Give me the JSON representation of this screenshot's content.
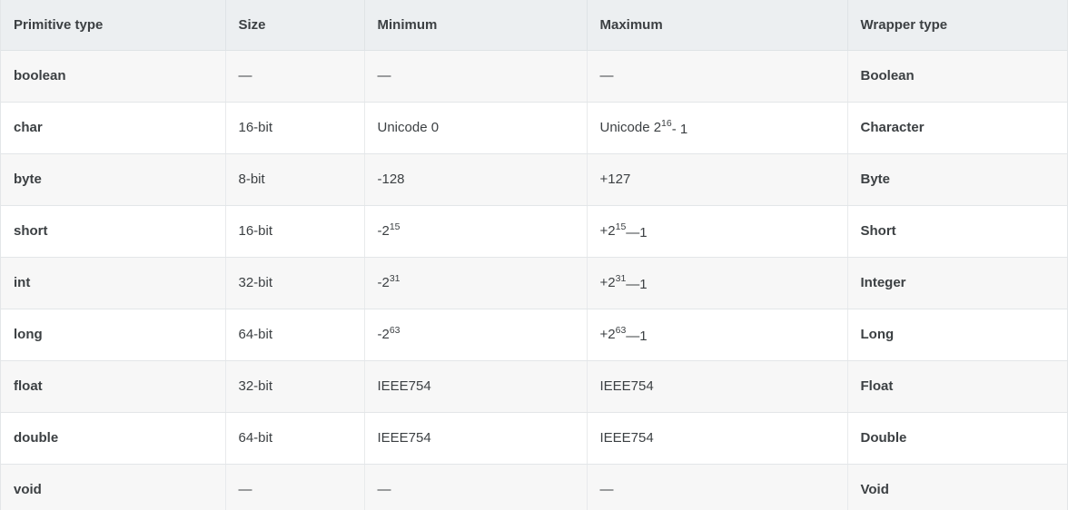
{
  "table": {
    "columns": [
      {
        "key": "primitive",
        "label": "Primitive type"
      },
      {
        "key": "size",
        "label": "Size"
      },
      {
        "key": "minimum",
        "label": "Minimum"
      },
      {
        "key": "maximum",
        "label": "Maximum"
      },
      {
        "key": "wrapper",
        "label": "Wrapper type"
      }
    ],
    "rows": [
      {
        "primitive": "boolean",
        "size": "—",
        "minimum": "—",
        "maximum": "—",
        "wrapper": "Boolean"
      },
      {
        "primitive": "char",
        "size": "16-bit",
        "minimum": "Unicode 0",
        "maximum": "Unicode 2¹⁶- 1",
        "maximum_parts": {
          "base": "Unicode 2",
          "sup": "16",
          "tail": "- 1"
        },
        "wrapper": "Character"
      },
      {
        "primitive": "byte",
        "size": "8-bit",
        "minimum": "-128",
        "maximum": "+127",
        "wrapper": "Byte"
      },
      {
        "primitive": "short",
        "size": "16-bit",
        "minimum": "-2¹⁵",
        "minimum_parts": {
          "base": "-2",
          "sup": "15",
          "tail": ""
        },
        "maximum": "+2¹⁵—1",
        "maximum_parts": {
          "base": "+2",
          "sup": "15",
          "tail": "—1"
        },
        "wrapper": "Short"
      },
      {
        "primitive": "int",
        "size": "32-bit",
        "minimum": "-2³¹",
        "minimum_parts": {
          "base": "-2",
          "sup": "31",
          "tail": ""
        },
        "maximum": "+2³¹—1",
        "maximum_parts": {
          "base": "+2",
          "sup": "31",
          "tail": "—1"
        },
        "wrapper": "Integer"
      },
      {
        "primitive": "long",
        "size": "64-bit",
        "minimum": "-2⁶³",
        "minimum_parts": {
          "base": "-2",
          "sup": "63",
          "tail": ""
        },
        "maximum": "+2⁶³—1",
        "maximum_parts": {
          "base": "+2",
          "sup": "63",
          "tail": "—1"
        },
        "wrapper": "Long"
      },
      {
        "primitive": "float",
        "size": "32-bit",
        "minimum": "IEEE754",
        "maximum": "IEEE754",
        "wrapper": "Float"
      },
      {
        "primitive": "double",
        "size": "64-bit",
        "minimum": "IEEE754",
        "maximum": "IEEE754",
        "wrapper": "Double"
      },
      {
        "primitive": "void",
        "size": "—",
        "minimum": "—",
        "maximum": "—",
        "wrapper": "Void"
      }
    ]
  },
  "colors": {
    "header_background": "#eceff1",
    "row_odd_background": "#f7f7f7",
    "row_even_background": "#ffffff",
    "text": "#3c4043",
    "border": "#e3e6e8"
  }
}
